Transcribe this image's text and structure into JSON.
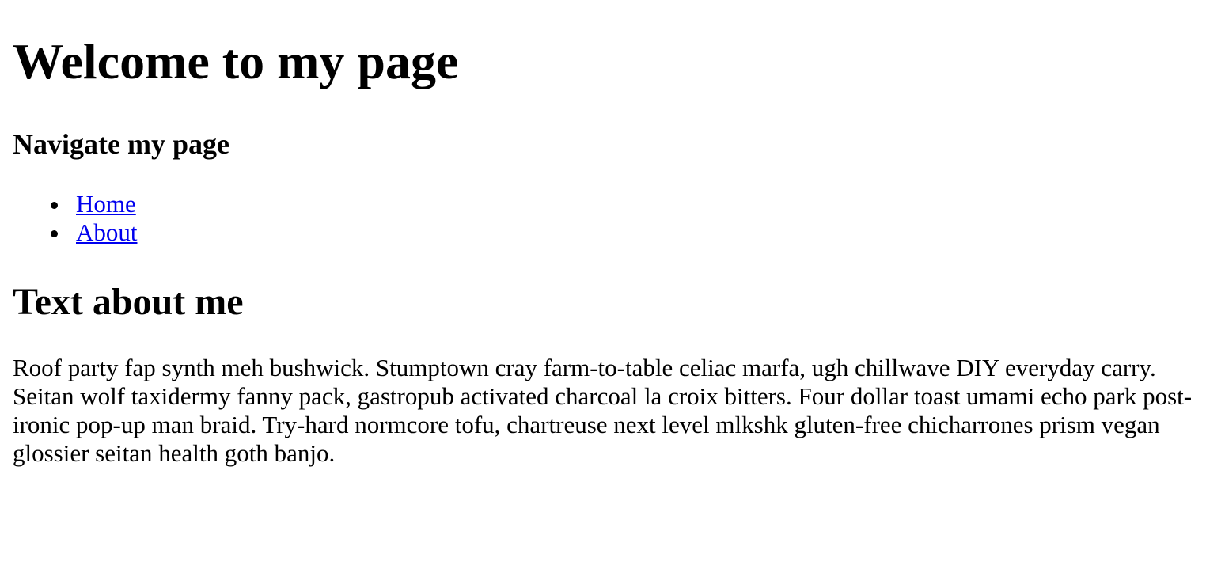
{
  "header": {
    "title": "Welcome to my page"
  },
  "nav": {
    "heading": "Navigate my page",
    "items": [
      {
        "label": "Home"
      },
      {
        "label": "About"
      }
    ]
  },
  "about": {
    "heading": "Text about me",
    "body": "Roof party fap synth meh bushwick. Stumptown cray farm-to-table celiac marfa, ugh chillwave DIY everyday carry. Seitan wolf taxidermy fanny pack, gastropub activated charcoal la croix bitters. Four dollar toast umami echo park post-ironic pop-up man braid. Try-hard normcore tofu, chartreuse next level mlkshk gluten-free chicharrones prism vegan glossier seitan health goth banjo."
  },
  "colors": {
    "link": "#0000ee",
    "text": "#000000",
    "background": "#ffffff"
  }
}
